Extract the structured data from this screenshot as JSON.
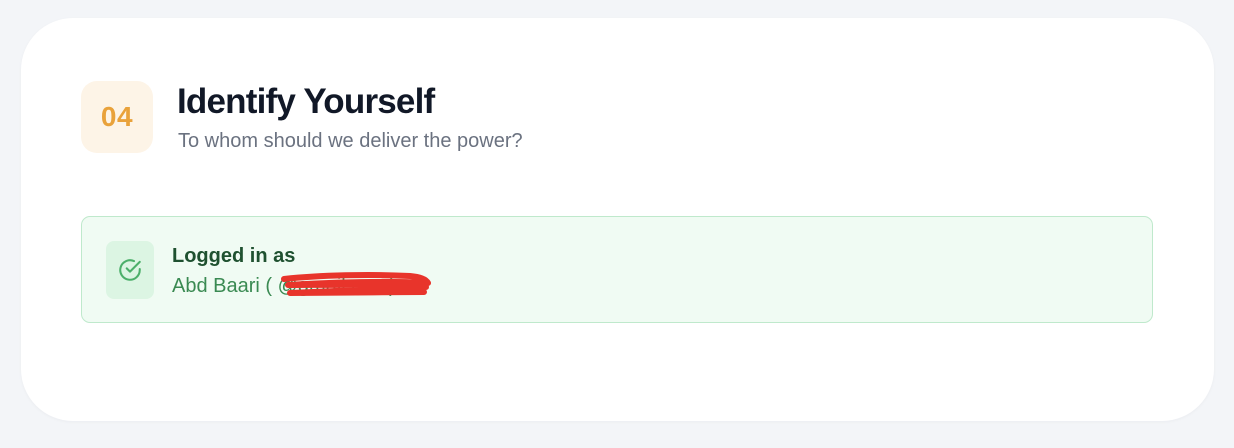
{
  "step": {
    "number": "04",
    "title": "Identify Yourself",
    "subtitle": "To whom should we deliver the power?"
  },
  "login": {
    "label": "Logged in as",
    "user_text": "Abd Baari (              @gmail.com)",
    "icon": "check-circle-icon"
  },
  "colors": {
    "page_bg": "#f3f5f8",
    "card_bg": "#ffffff",
    "badge_bg": "#fdf4e7",
    "badge_text": "#e9a23b",
    "success_bg": "#f0fbf3",
    "success_border": "#bfe9cc",
    "success_icon": "#4caf6a",
    "redaction": "#e8342b"
  }
}
